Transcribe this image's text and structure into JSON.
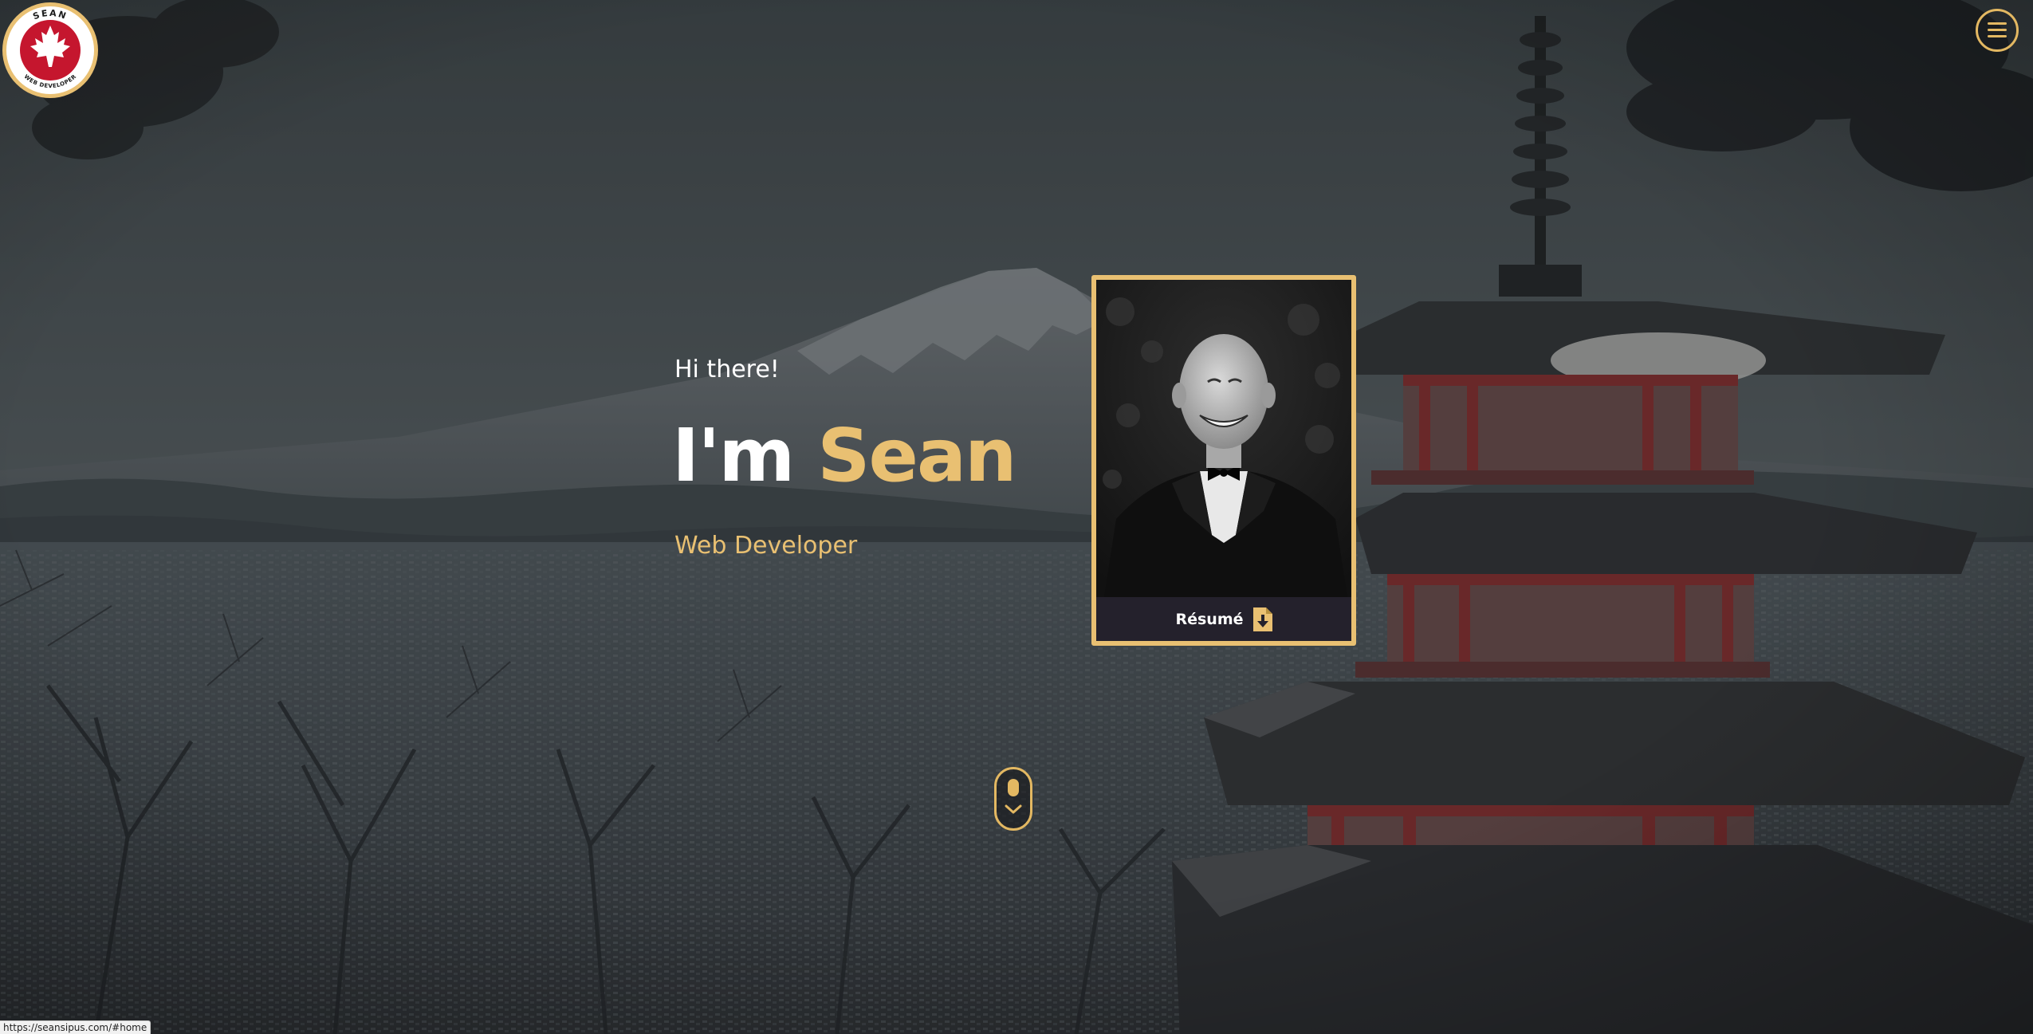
{
  "logo": {
    "text_top": "SEAN",
    "text_bottom": "WEB DEVELOPER"
  },
  "hero": {
    "greeting": "Hi there!",
    "headline_prefix": "I'm",
    "headline_name": "Sean",
    "subtitle": "Web Developer"
  },
  "profile_card": {
    "resume_label": "Résumé"
  },
  "status_bar": {
    "url": "https://seansipus.com/#home"
  },
  "icons": {
    "menu": "hamburger-menu-icon",
    "download": "download-file-icon",
    "scroll": "mouse-scroll-icon",
    "chevron": "chevron-down-icon",
    "logo_emblem": "maple-leaf-icon"
  },
  "colors": {
    "accent": "#e9c072",
    "card_footer": "#24212c",
    "overlay": "#2c3136",
    "logo_red": "#c5162e"
  }
}
